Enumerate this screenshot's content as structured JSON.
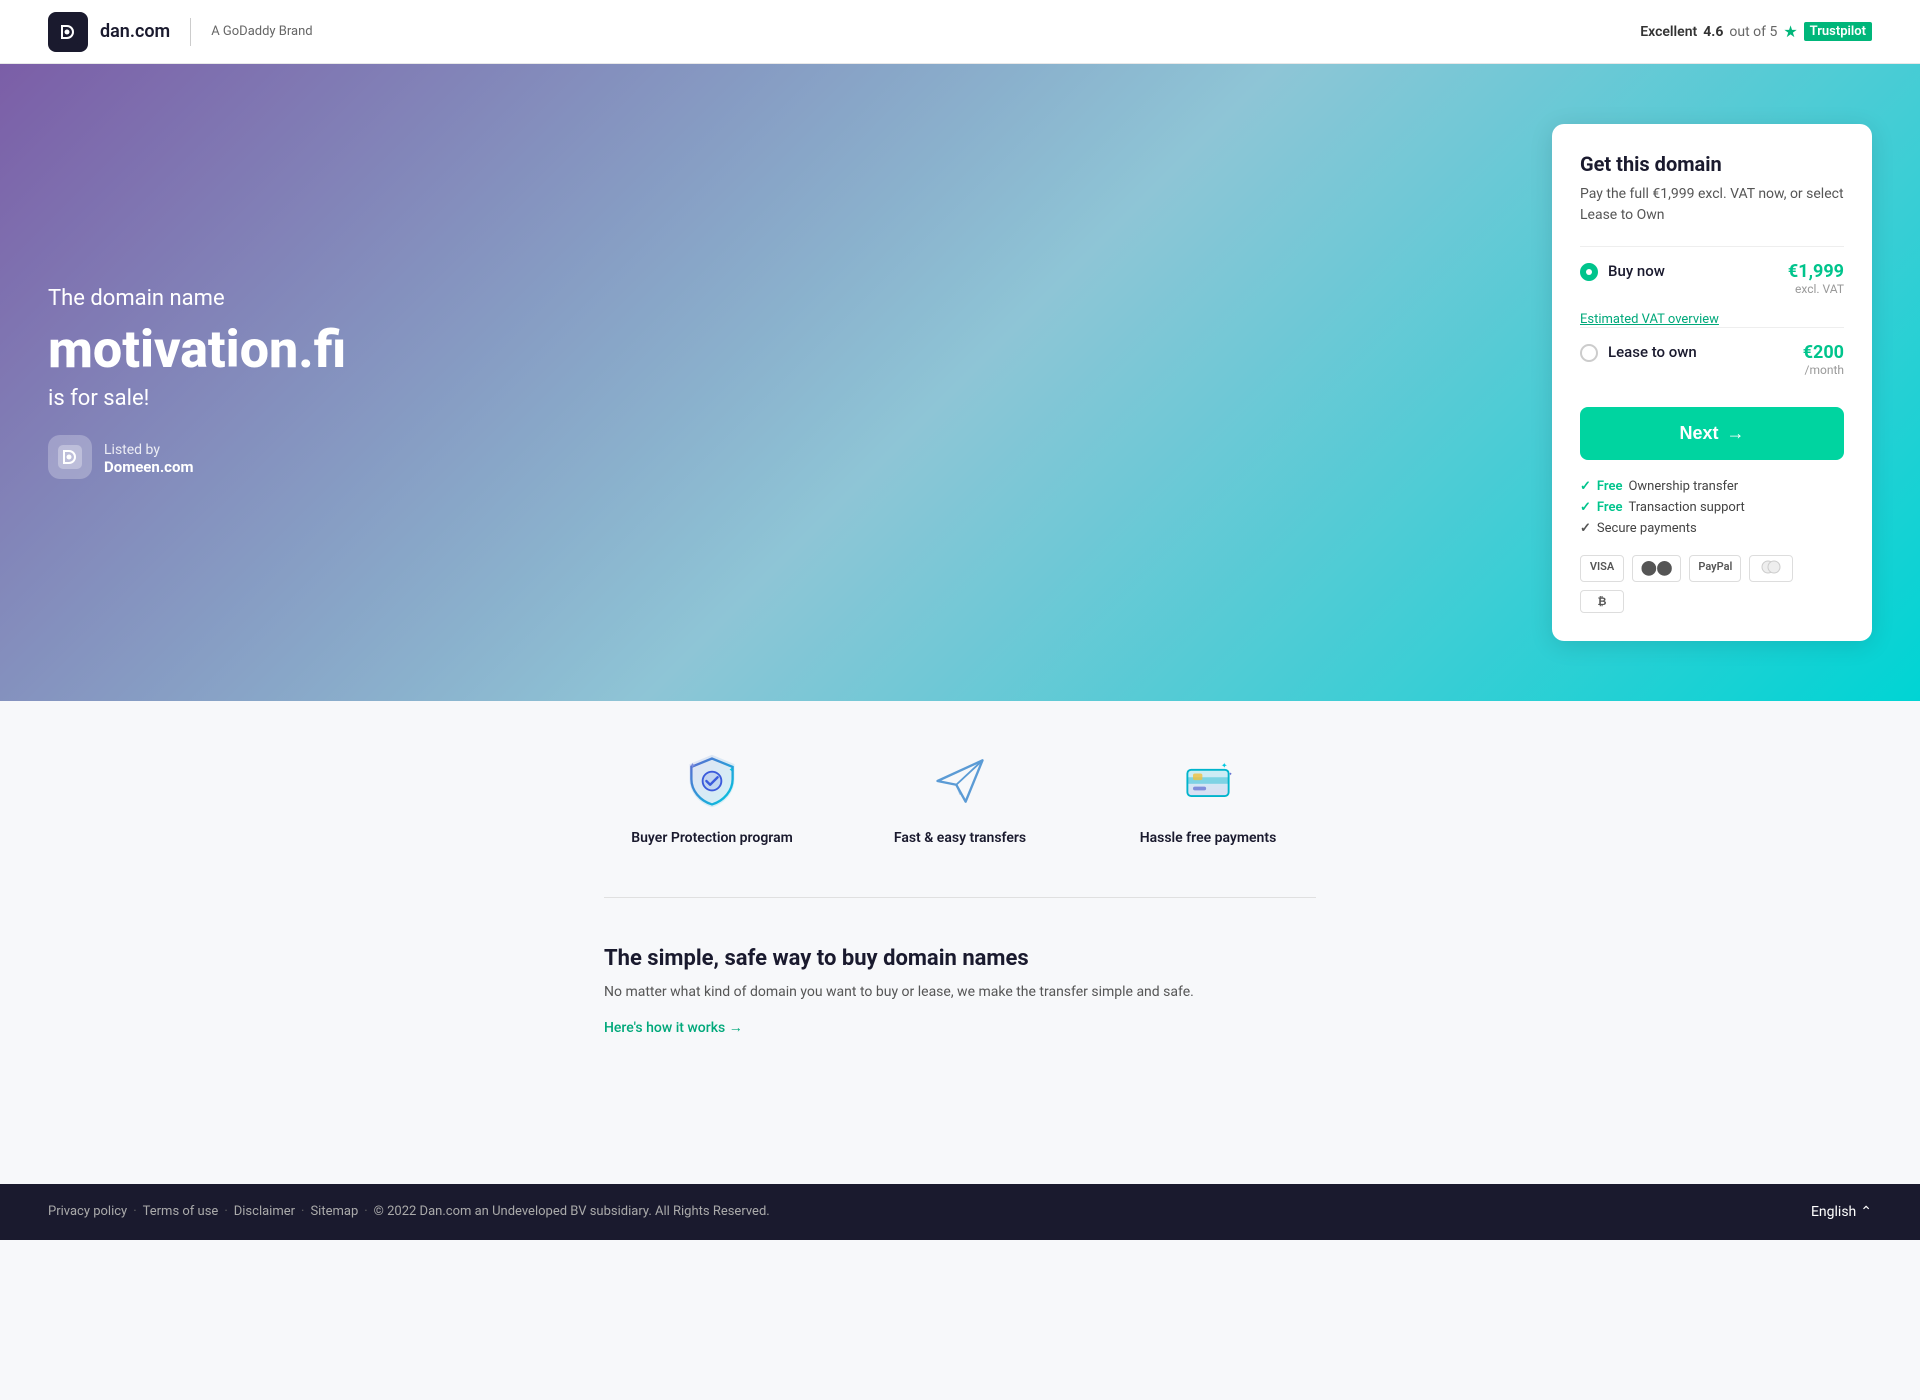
{
  "header": {
    "logo_text": "dan.com",
    "logo_short": "d",
    "brand": "A GoDaddy Brand",
    "trustpilot_label": "Excellent",
    "trustpilot_score": "4.6",
    "trustpilot_of": "out of 5",
    "trustpilot_name": "Trustpilot"
  },
  "hero": {
    "subtitle": "The domain name",
    "domain": "motivation.fi",
    "forsale": "is for sale!",
    "listed_by": "Listed by",
    "seller": "Domeen.com"
  },
  "card": {
    "title": "Get this domain",
    "subtitle": "Pay the full €1,999 excl. VAT now, or select Lease to Own",
    "buy_now_label": "Buy now",
    "buy_price": "€1,999",
    "buy_excl": "excl. VAT",
    "vat_link": "Estimated VAT overview",
    "lease_label": "Lease to own",
    "lease_price": "€200",
    "lease_per": "/month",
    "next_label": "Next",
    "next_arrow": "→",
    "features": [
      {
        "icon": "check",
        "color": "green",
        "text": "Free Ownership transfer"
      },
      {
        "icon": "check",
        "color": "green",
        "text": "Free Transaction support"
      },
      {
        "icon": "check",
        "color": "grey",
        "text": "Secure payments"
      }
    ],
    "payments": [
      "VISA",
      "MC",
      "PayPal",
      "●●",
      "₿"
    ]
  },
  "features": [
    {
      "label": "Buyer Protection program",
      "icon": "shield"
    },
    {
      "label": "Fast & easy transfers",
      "icon": "paper-plane"
    },
    {
      "label": "Hassle free payments",
      "icon": "card"
    }
  ],
  "info": {
    "title": "The simple, safe way to buy domain names",
    "description": "No matter what kind of domain you want to buy or lease, we make the transfer simple and safe.",
    "how_link": "Here's how it works",
    "how_arrow": "→"
  },
  "footer": {
    "links": [
      {
        "label": "Privacy policy"
      },
      {
        "label": "Terms of use"
      },
      {
        "label": "Disclaimer"
      },
      {
        "label": "Sitemap"
      }
    ],
    "copyright": "© 2022 Dan.com an Undeveloped BV subsidiary. All Rights Reserved.",
    "language": "English",
    "lang_arrow": "⌃"
  }
}
